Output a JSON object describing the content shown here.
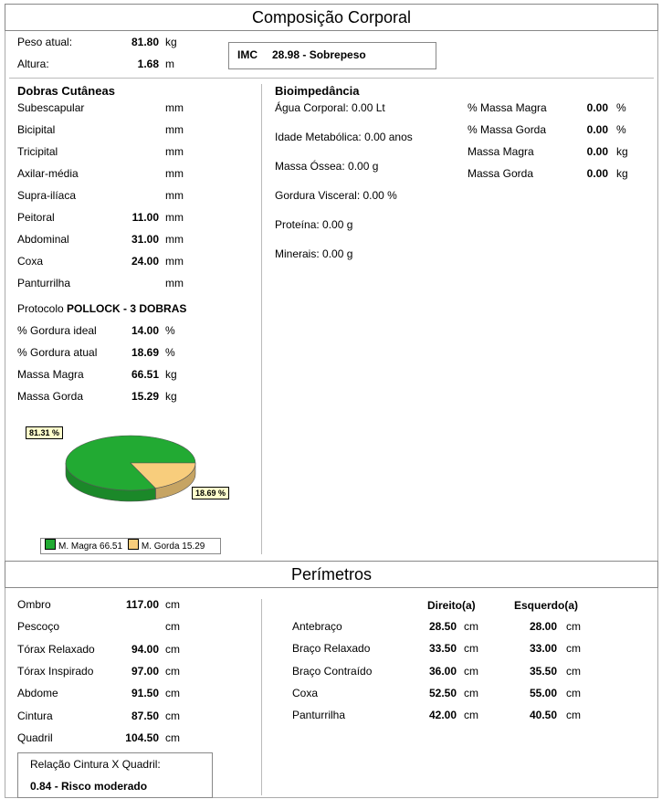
{
  "title": "Composição Corporal",
  "basics": {
    "peso_label": "Peso atual:",
    "peso_value": "81.80",
    "peso_unit": "kg",
    "altura_label": "Altura:",
    "altura_value": "1.68",
    "altura_unit": "m",
    "imc_label": "IMC",
    "imc_value": "28.98 - Sobrepeso"
  },
  "dobras": {
    "title": "Dobras Cutâneas",
    "rows": [
      {
        "label": "Subescapular",
        "value": "",
        "unit": "mm"
      },
      {
        "label": "Bicipital",
        "value": "",
        "unit": "mm"
      },
      {
        "label": "Tricipital",
        "value": "",
        "unit": "mm"
      },
      {
        "label": "Axilar-média",
        "value": "",
        "unit": "mm"
      },
      {
        "label": "Supra-ilíaca",
        "value": "",
        "unit": "mm"
      },
      {
        "label": "Peitoral",
        "value": "11.00",
        "unit": "mm"
      },
      {
        "label": "Abdominal",
        "value": "31.00",
        "unit": "mm"
      },
      {
        "label": "Coxa",
        "value": "24.00",
        "unit": "mm"
      },
      {
        "label": "Panturrilha",
        "value": "",
        "unit": "mm"
      }
    ],
    "protocolo_label": "Protocolo",
    "protocolo_value": "POLLOCK - 3 DOBRAS",
    "results": [
      {
        "label": "% Gordura ideal",
        "value": "14.00",
        "unit": "%"
      },
      {
        "label": "% Gordura atual",
        "value": "18.69",
        "unit": "%"
      },
      {
        "label": "Massa Magra",
        "value": "66.51",
        "unit": "kg"
      },
      {
        "label": "Massa Gorda",
        "value": "15.29",
        "unit": "kg"
      }
    ]
  },
  "bio": {
    "title": "Bioimpedância",
    "left": [
      "Água Corporal: 0.00 Lt",
      "Idade Metabólica: 0.00 anos",
      "Massa Óssea: 0.00 g",
      "Gordura Visceral: 0.00 %",
      "Proteína: 0.00 g",
      "Minerais: 0.00 g"
    ],
    "right": [
      {
        "label": "% Massa Magra",
        "value": "0.00",
        "unit": "%"
      },
      {
        "label": "% Massa Gorda",
        "value": "0.00",
        "unit": "%"
      },
      {
        "label": "Massa Magra",
        "value": "0.00",
        "unit": "kg"
      },
      {
        "label": "Massa Gorda",
        "value": "0.00",
        "unit": "kg"
      }
    ]
  },
  "chart_data": {
    "type": "pie",
    "slices": [
      {
        "label": "M. Magra 66.51",
        "value": 66.51,
        "percent_label": "81.31 %",
        "color": "#22aa33"
      },
      {
        "label": "M. Gorda 15.29",
        "value": 15.29,
        "percent_label": "18.69 %",
        "color": "#f8cd7c"
      }
    ],
    "legend": "bottom"
  },
  "perimetros": {
    "title": "Perímetros",
    "left": [
      {
        "label": "Ombro",
        "value": "117.00",
        "unit": "cm"
      },
      {
        "label": "Pescoço",
        "value": "",
        "unit": "cm"
      },
      {
        "label": "Tórax Relaxado",
        "value": "94.00",
        "unit": "cm"
      },
      {
        "label": "Tórax Inspirado",
        "value": "97.00",
        "unit": "cm"
      },
      {
        "label": "Abdome",
        "value": "91.50",
        "unit": "cm"
      },
      {
        "label": "Cintura",
        "value": "87.50",
        "unit": "cm"
      },
      {
        "label": "Quadril",
        "value": "104.50",
        "unit": "cm"
      }
    ],
    "direito_header": "Direito(a)",
    "esquerdo_header": "Esquerdo(a)",
    "right": [
      {
        "label": "Antebraço",
        "dir": "28.50",
        "esq": "28.00",
        "unit": "cm"
      },
      {
        "label": "Braço Relaxado",
        "dir": "33.50",
        "esq": "33.00",
        "unit": "cm"
      },
      {
        "label": "Braço Contraído",
        "dir": "36.00",
        "esq": "35.50",
        "unit": "cm"
      },
      {
        "label": "Coxa",
        "dir": "52.50",
        "esq": "55.00",
        "unit": "cm"
      },
      {
        "label": "Panturrilha",
        "dir": "42.00",
        "esq": "40.50",
        "unit": "cm"
      }
    ],
    "rcq_label": "Relação Cintura X Quadril:",
    "rcq_value": "0.84 - Risco moderado"
  }
}
